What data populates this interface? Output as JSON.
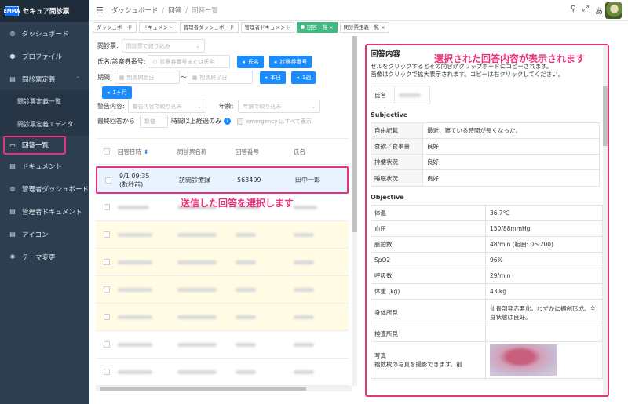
{
  "app": {
    "logo_text": "EMMA",
    "name": "セキュア問診票"
  },
  "sidebar": {
    "items": [
      {
        "label": "ダッシュボード",
        "icon": "dashboard-icon"
      },
      {
        "label": "プロファイル",
        "icon": "user-icon"
      },
      {
        "label": "問診票定義",
        "icon": "document-icon",
        "expanded": true
      },
      {
        "label": "問診票定義一覧",
        "sub": true
      },
      {
        "label": "問診票定義エディタ",
        "sub": true
      },
      {
        "label": "回答一覧",
        "icon": "inbox-icon",
        "active": true
      },
      {
        "label": "ドキュメント",
        "icon": "document-icon"
      },
      {
        "label": "管理者ダッシュボード",
        "icon": "dashboard-icon"
      },
      {
        "label": "管理者ドキュメント",
        "icon": "document-icon"
      },
      {
        "label": "アイコン",
        "icon": "document-icon"
      },
      {
        "label": "テーマ変更",
        "icon": "palette-icon"
      }
    ]
  },
  "breadcrumb": [
    "ダッシュボード",
    "回答",
    "回答一覧"
  ],
  "tabs": [
    "ダッシュボード",
    "ドキュメント",
    "管理者ダッシュボード",
    "管理者ドキュメント",
    "回答一覧 ×",
    "問診票定義一覧 ×"
  ],
  "filters": {
    "form_label": "問診票:",
    "form_placeholder": "問診票で絞り込み",
    "name_label": "氏名/診察券番号:",
    "name_placeholder": "診察券番号または氏名",
    "btn_name": "氏名",
    "btn_card": "診察券番号",
    "period_label": "期間:",
    "period_start": "期間開始日",
    "tilde": "〜",
    "period_end": "期間終了日",
    "btn_today": "本日",
    "btn_week": "1週",
    "btn_month": "1ヶ月",
    "warning_label": "警告内容:",
    "warning_placeholder": "警告内容で絞り込み",
    "age_label": "年齢:",
    "age_placeholder": "年齢で絞り込み",
    "last_answer_label": "最終回答から",
    "hours_placeholder": "数値",
    "hours_suffix": "時間以上経過のみ",
    "emergency_text": "emergency はすべて表示"
  },
  "table": {
    "headers": [
      "回答日時",
      "問診票名称",
      "回答番号",
      "氏名"
    ],
    "selected_row": {
      "date": "9/1 09:35",
      "ago": "(数秒前)",
      "form": "訪問診療録",
      "number": "563409",
      "name": "田中一郎"
    }
  },
  "annotations": {
    "select_note": "送信した回答を選択します",
    "detail_note": "選択された回答内容が表示されます"
  },
  "detail": {
    "title": "回答内容",
    "desc1": "セルをクリックするとその内容がクリップボードにコピーされます。",
    "desc2": "画像はクリックで拡大表示されます。コピーは右クリックしてください。",
    "name_label": "氏名",
    "subjective_title": "Subjective",
    "subjective": [
      [
        "自由記載",
        "最近、寝ている時間が長くなった。"
      ],
      [
        "食欲／食事量",
        "良好"
      ],
      [
        "排便状況",
        "良好"
      ],
      [
        "睡眠状況",
        "良好"
      ]
    ],
    "objective_title": "Objective",
    "objective": [
      [
        "体温",
        "36.7℃"
      ],
      [
        "血圧",
        "150/88mmHg"
      ],
      [
        "脈拍数",
        "48/min (範囲: 0〜200)"
      ],
      [
        "SpO2",
        "96%"
      ],
      [
        "呼吸数",
        "29/min"
      ],
      [
        "体重 (kg)",
        "43 kg"
      ],
      [
        "身体所見",
        "仙骨部発赤悪化。わずかに褥創形成。全身状態は良好。"
      ],
      [
        "検査所見",
        ""
      ]
    ],
    "photo_label": "写真",
    "photo_desc": "複数枚の写真を撮影できます。削"
  }
}
